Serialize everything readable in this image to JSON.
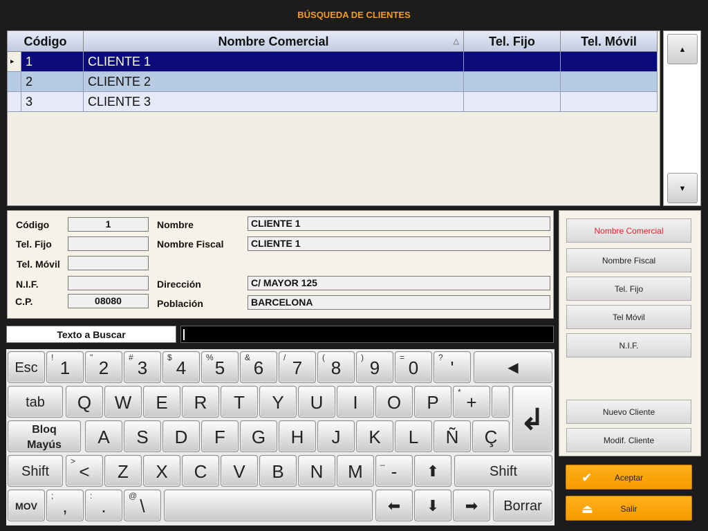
{
  "title": "BÚSQUEDA DE CLIENTES",
  "grid": {
    "columns": [
      "Código",
      "Nombre Comercial",
      "Tel. Fijo",
      "Tel. Móvil"
    ],
    "sort_indicator": "△",
    "rows": [
      {
        "codigo": "1",
        "nombre": "CLIENTE 1",
        "tel_fijo": "",
        "tel_movil": "",
        "selected": true
      },
      {
        "codigo": "2",
        "nombre": "CLIENTE 2",
        "tel_fijo": "",
        "tel_movil": ""
      },
      {
        "codigo": "3",
        "nombre": "CLIENTE 3",
        "tel_fijo": "",
        "tel_movil": ""
      }
    ],
    "row_pointer": "▸"
  },
  "scroll": {
    "up": "▲",
    "down": "▼"
  },
  "detail": {
    "codigo_label": "Código",
    "codigo": "1",
    "tel_fijo_label": "Tel. Fijo",
    "tel_fijo": "",
    "tel_movil_label": "Tel. Móvil",
    "tel_movil": "",
    "nif_label": "N.I.F.",
    "nif": "",
    "cp_label": "C.P.",
    "cp": "08080",
    "nombre_label": "Nombre",
    "nombre": "CLIENTE 1",
    "nombre_fiscal_label": "Nombre Fiscal",
    "nombre_fiscal": "CLIENTE 1",
    "direccion_label": "Dirección",
    "direccion": "C/ MAYOR 125",
    "poblacion_label": "Población",
    "poblacion": "BARCELONA"
  },
  "search": {
    "label": "Texto a Buscar",
    "value": ""
  },
  "keyboard": {
    "esc": "Esc",
    "tab": "tab",
    "bloq1": "Bloq",
    "bloq2": "Mayús",
    "shift": "Shift",
    "mov": "MOV",
    "borrar": "Borrar",
    "backspace": "◀",
    "enter": "↲",
    "up": "⬆",
    "down": "⬇",
    "left": "⬅",
    "right": "➡",
    "row1": [
      {
        "k": "1",
        "s": "!"
      },
      {
        "k": "2",
        "s": "\""
      },
      {
        "k": "3",
        "s": "#"
      },
      {
        "k": "4",
        "s": "$"
      },
      {
        "k": "5",
        "s": "%"
      },
      {
        "k": "6",
        "s": "&"
      },
      {
        "k": "7",
        "s": "/"
      },
      {
        "k": "8",
        "s": "("
      },
      {
        "k": "9",
        "s": ")"
      },
      {
        "k": "0",
        "s": "="
      },
      {
        "k": "'",
        "s": "?"
      }
    ],
    "row2": [
      "Q",
      "W",
      "E",
      "R",
      "T",
      "Y",
      "U",
      "I",
      "O",
      "P"
    ],
    "plus": {
      "k": "+",
      "s": "*"
    },
    "row3": [
      "A",
      "S",
      "D",
      "F",
      "G",
      "H",
      "J",
      "K",
      "L",
      "Ñ",
      "Ç"
    ],
    "row4": [
      {
        "k": "<",
        "s": ">"
      },
      {
        "k": "Z",
        "s": ""
      },
      {
        "k": "X",
        "s": ""
      },
      {
        "k": "C",
        "s": ""
      },
      {
        "k": "V",
        "s": ""
      },
      {
        "k": "B",
        "s": ""
      },
      {
        "k": "N",
        "s": ""
      },
      {
        "k": "M",
        "s": ""
      },
      {
        "k": "-",
        "s": "_"
      }
    ],
    "row5": [
      {
        "k": ",",
        "s": ";"
      },
      {
        "k": ".",
        "s": ":"
      },
      {
        "k": "\\",
        "s": "@"
      }
    ]
  },
  "right_panel": {
    "sort_buttons": [
      "Nombre Comercial",
      "Nombre Fiscal",
      "Tel. Fijo",
      "Tel Móvil",
      "N.I.F."
    ],
    "active_sort_color": "#e0202a",
    "nuevo": "Nuevo Cliente",
    "modif": "Modif. Cliente"
  },
  "actions": {
    "aceptar": "Aceptar",
    "salir": "Salir",
    "accent": "#ffa500"
  }
}
